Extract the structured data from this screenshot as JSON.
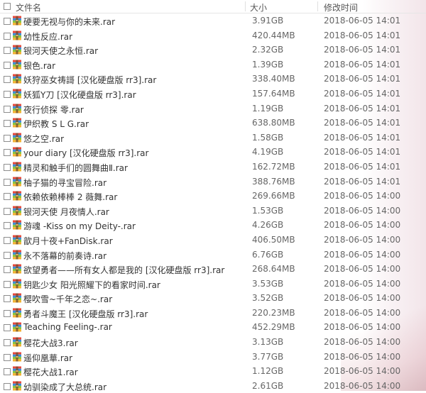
{
  "columns": {
    "name": "文件名",
    "size": "大小",
    "time": "修改时间"
  },
  "files": [
    {
      "name": "硬要无视与你的未来.rar",
      "size": "3.91GB",
      "time": "2018-06-05 14:01"
    },
    {
      "name": "幼性反应.rar",
      "size": "420.44MB",
      "time": "2018-06-05 14:01"
    },
    {
      "name": "银河天使之永恒.rar",
      "size": "2.32GB",
      "time": "2018-06-05 14:01"
    },
    {
      "name": "银色.rar",
      "size": "1.39GB",
      "time": "2018-06-05 14:01"
    },
    {
      "name": "妖狩巫女祷謌 [汉化硬盘版 rr3].rar",
      "size": "338.40MB",
      "time": "2018-06-05 14:01"
    },
    {
      "name": "妖狐Y刀 [汉化硬盘版 rr3].rar",
      "size": "157.64MB",
      "time": "2018-06-05 14:01"
    },
    {
      "name": "夜行侦探 零.rar",
      "size": "1.19GB",
      "time": "2018-06-05 14:01"
    },
    {
      "name": "伊织教 S L G.rar",
      "size": "638.80MB",
      "time": "2018-06-05 14:01"
    },
    {
      "name": "悠之空.rar",
      "size": "1.58GB",
      "time": "2018-06-05 14:01"
    },
    {
      "name": "your diary [汉化硬盘版 rr3].rar",
      "size": "4.19GB",
      "time": "2018-06-05 14:01"
    },
    {
      "name": "精灵和触手们的圆舞曲Ⅱ.rar",
      "size": "162.72MB",
      "time": "2018-06-05 14:01"
    },
    {
      "name": "柚子猫的寻宝冒险.rar",
      "size": "388.76MB",
      "time": "2018-06-05 14:01"
    },
    {
      "name": "依赖依赖棒棒 2 薇舞.rar",
      "size": "269.66MB",
      "time": "2018-06-05 14:00"
    },
    {
      "name": "银河天使 月夜情人.rar",
      "size": "1.53GB",
      "time": "2018-06-05 14:00"
    },
    {
      "name": "游魂 -Kiss on my Deity-.rar",
      "size": "4.26GB",
      "time": "2018-06-05 14:00"
    },
    {
      "name": "歆月十夜+FanDisk.rar",
      "size": "406.50MB",
      "time": "2018-06-05 14:00"
    },
    {
      "name": "永不落幕的前奏诗.rar",
      "size": "6.76GB",
      "time": "2018-06-05 14:00"
    },
    {
      "name": "欲望勇者——所有女人都是我的 [汉化硬盘版 rr3].rar",
      "size": "268.64MB",
      "time": "2018-06-05 14:00"
    },
    {
      "name": "钥匙少女 阳光照耀下的看家时间.rar",
      "size": "3.53GB",
      "time": "2018-06-05 14:00"
    },
    {
      "name": "樱吹雪~千年之恋~.rar",
      "size": "3.52GB",
      "time": "2018-06-05 14:00"
    },
    {
      "name": "勇者斗魔王 [汉化硬盘版 rr3].rar",
      "size": "220.23MB",
      "time": "2018-06-05 14:00"
    },
    {
      "name": "Teaching Feeling-.rar",
      "size": "452.29MB",
      "time": "2018-06-05 14:00"
    },
    {
      "name": "樱花大战3.rar",
      "size": "3.13GB",
      "time": "2018-06-05 14:00"
    },
    {
      "name": "遥仰凰華.rar",
      "size": "3.77GB",
      "time": "2018-06-05 14:00"
    },
    {
      "name": "樱花大战1.rar",
      "size": "1.12GB",
      "time": "2018-06-05 14:00"
    },
    {
      "name": "幼驯染成了大总统.rar",
      "size": "2.61GB",
      "time": "2018-06-05 14:00"
    }
  ],
  "icon": "rar-archive-icon",
  "colors": {
    "icon_band_1": "#e64a3c",
    "icon_band_2": "#3b8fd9",
    "icon_band_3": "#8cc63f",
    "icon_band_4": "#f2b233",
    "text": "#333333",
    "meta_text": "#666666"
  }
}
